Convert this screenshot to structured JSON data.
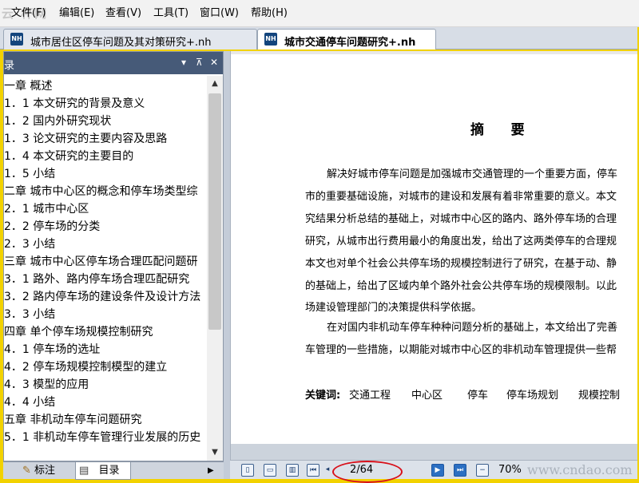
{
  "menubar": {
    "watermark": "云 杯网",
    "items": [
      "文件(F)",
      "编辑(E)",
      "查看(V)",
      "工具(T)",
      "窗口(W)",
      "帮助(H)"
    ]
  },
  "tabs": [
    {
      "icon": "NH",
      "label": "城市居住区停车问题及其对策研究+.nh",
      "active": false
    },
    {
      "icon": "NH",
      "label": "城市交通停车问题研究+.nh",
      "active": true
    }
  ],
  "toc": {
    "header_label": "录",
    "header_controls": {
      "dropdown": "▾",
      "pin": "⊼",
      "close": "✕"
    },
    "items": [
      "一章 概述",
      "1．1 本文研究的背景及意义",
      "1．2 国内外研究现状",
      "1．3 论文研究的主要内容及思路",
      "1．4 本文研究的主要目的",
      "1．5 小结",
      "二章 城市中心区的概念和停车场类型综",
      "2．1 城市中心区",
      "2．2 停车场的分类",
      "2．3 小结",
      "三章 城市中心区停车场合理匹配问题研",
      "3．1 路外、路内停车场合理匹配研究",
      "3．2 路内停车场的建设条件及设计方法",
      "3．3 小结",
      "四章 单个停车场规模控制研究",
      "4．1 停车场的选址",
      "4．2 停车场规模控制模型的建立",
      "4．3 模型的应用",
      "4．4 小结",
      "五章 非机动车停车问题研究",
      "5．1 非机动车停车管理行业发展的历史"
    ]
  },
  "left_tabs": {
    "annotation": "标注",
    "toc": "目录"
  },
  "document": {
    "title": "摘    要",
    "paragraph_lines": [
      "解决好城市停车问题是加强城市交通管理的一个重要方面，停车",
      "市的重要基础设施，对城市的建设和发展有着非常重要的意义。本文",
      "究结果分析总结的基础上，对城市中心区的路内、路外停车场的合理",
      "研究，从城市出行费用最小的角度出发，给出了这两类停车的合理规",
      "本文也对单个社会公共停车场的规模控制进行了研究，在基于动、静",
      "的基础上，给出了区域内单个路外社会公共停车场的规模限制。以此",
      "场建设管理部门的决策提供科学依据。",
      "在对国内非机动车停车种种问题分析的基础上，本文给出了完善",
      "车管理的一些措施，以期能对城市中心区的非机动车管理提供一些帮"
    ],
    "keywords_label": "关键词:",
    "keywords": [
      "交通工程",
      "中心区",
      "停车",
      "停车场规划",
      "规模控制"
    ]
  },
  "bottom_toolbar": {
    "page_indicator": "2/64",
    "zoom": "70%",
    "watermark": "www.cndao.com"
  },
  "colors": {
    "frame": "#f2d200",
    "toc_header": "#465a78",
    "highlight_circle": "#d8101a"
  }
}
